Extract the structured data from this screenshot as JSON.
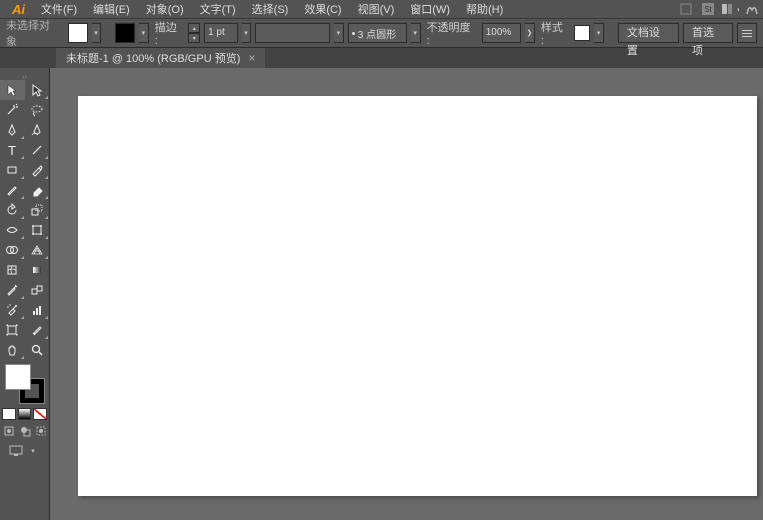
{
  "menu": {
    "items": [
      "文件(F)",
      "编辑(E)",
      "对象(O)",
      "文字(T)",
      "选择(S)",
      "效果(C)",
      "视图(V)",
      "窗口(W)",
      "帮助(H)"
    ]
  },
  "options": {
    "noSelection": "未选择对象",
    "strokeLabel": "描边 :",
    "strokeWeight": "1 pt",
    "strokeProfile": "3 点圆形",
    "opacityLabel": "不透明度 :",
    "opacityValue": "100%",
    "styleLabel": "样式 :",
    "docSetup": "文档设置",
    "preferences": "首选项"
  },
  "tab": {
    "title": "未标题-1 @ 100% (RGB/GPU 预览)"
  },
  "colors": {
    "fill": "#ffffff",
    "stroke": "#000000"
  }
}
